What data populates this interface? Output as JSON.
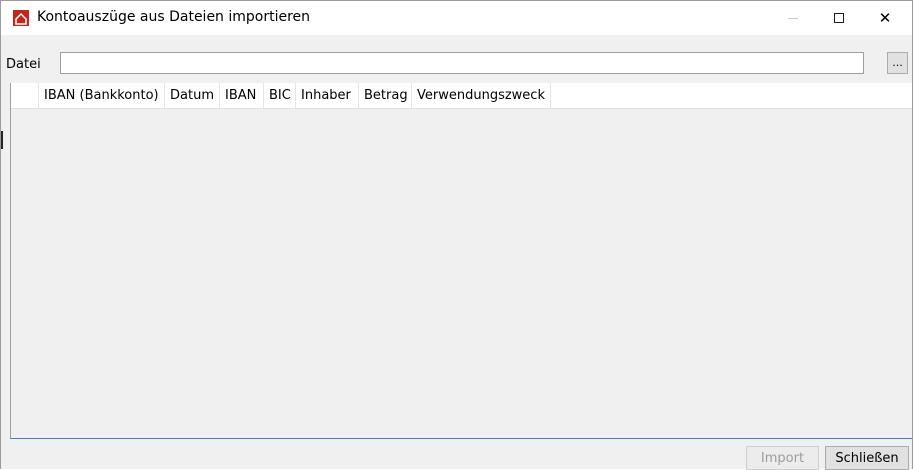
{
  "window": {
    "title": "Kontoauszüge aus Dateien importieren",
    "icon": "house-app-icon",
    "controls": {
      "minimize": "minimize-icon",
      "maximize": "maximize-icon",
      "close_glyph": "✕"
    }
  },
  "file": {
    "label": "Datei",
    "value": "",
    "browse_label": "..."
  },
  "table": {
    "columns": [
      "IBAN (Bankkonto)",
      "Datum",
      "IBAN",
      "BIC",
      "Inhaber",
      "Betrag",
      "Verwendungszweck"
    ],
    "rows": []
  },
  "footer": {
    "import_label": "Import",
    "close_label": "Schließen"
  },
  "colors": {
    "icon_red": "#c0281c",
    "grid_bottom_border": "#4a7bc4",
    "background": "#f0f0f0"
  }
}
